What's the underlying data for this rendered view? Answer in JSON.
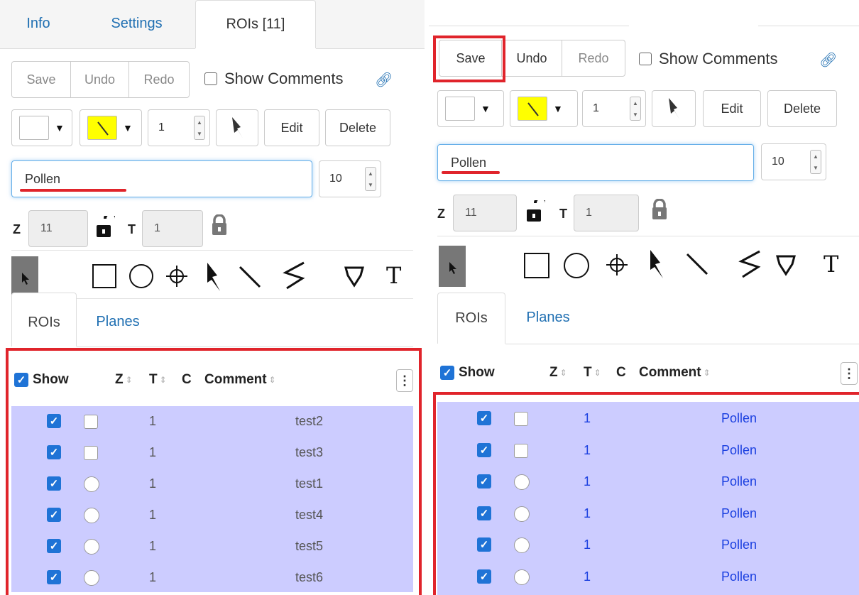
{
  "top_tabs": [
    {
      "label": "Info"
    },
    {
      "label": "Settings"
    },
    {
      "label": "ROIs [11]"
    }
  ],
  "toolbar": {
    "save_label": "Save",
    "undo_label": "Undo",
    "redo_label": "Redo",
    "show_comments_label": "Show Comments",
    "edit_label": "Edit",
    "delete_label": "Delete"
  },
  "style": {
    "stroke_width": "1",
    "fill_color": "#ffffff",
    "stroke_color": "#ffff00",
    "font_size": "10"
  },
  "comment_input": {
    "value": "Pollen"
  },
  "zt": {
    "z_label": "Z",
    "z_value": "11",
    "t_label": "T",
    "t_value": "1"
  },
  "tools": [
    "arrow-select",
    "rectangle",
    "ellipse",
    "point",
    "arrow",
    "line",
    "polyline",
    "polygon",
    "label"
  ],
  "tool_text_glyph": "T",
  "sub_tabs": [
    {
      "label": "ROIs"
    },
    {
      "label": "Planes"
    }
  ],
  "table": {
    "show_label": "Show",
    "col_z": "Z",
    "col_t": "T",
    "col_c": "C",
    "col_comment": "Comment"
  },
  "left_rows": [
    {
      "shape": "rectangle",
      "t": "1",
      "comment": "test2"
    },
    {
      "shape": "rectangle",
      "t": "1",
      "comment": "test3"
    },
    {
      "shape": "ellipse",
      "t": "1",
      "comment": "test1"
    },
    {
      "shape": "ellipse",
      "t": "1",
      "comment": "test4"
    },
    {
      "shape": "ellipse",
      "t": "1",
      "comment": "test5"
    },
    {
      "shape": "ellipse",
      "t": "1",
      "comment": "test6"
    }
  ],
  "right_rows": [
    {
      "shape": "rectangle",
      "t": "1",
      "comment": "Pollen"
    },
    {
      "shape": "rectangle",
      "t": "1",
      "comment": "Pollen"
    },
    {
      "shape": "ellipse",
      "t": "1",
      "comment": "Pollen"
    },
    {
      "shape": "ellipse",
      "t": "1",
      "comment": "Pollen"
    },
    {
      "shape": "ellipse",
      "t": "1",
      "comment": "Pollen"
    },
    {
      "shape": "ellipse",
      "t": "1",
      "comment": "Pollen"
    }
  ],
  "colors": {
    "highlight_red": "#e0242b",
    "row_bg": "#ccccff",
    "link_blue": "#1f6fb2",
    "checkbox_blue": "#1f73d6"
  }
}
